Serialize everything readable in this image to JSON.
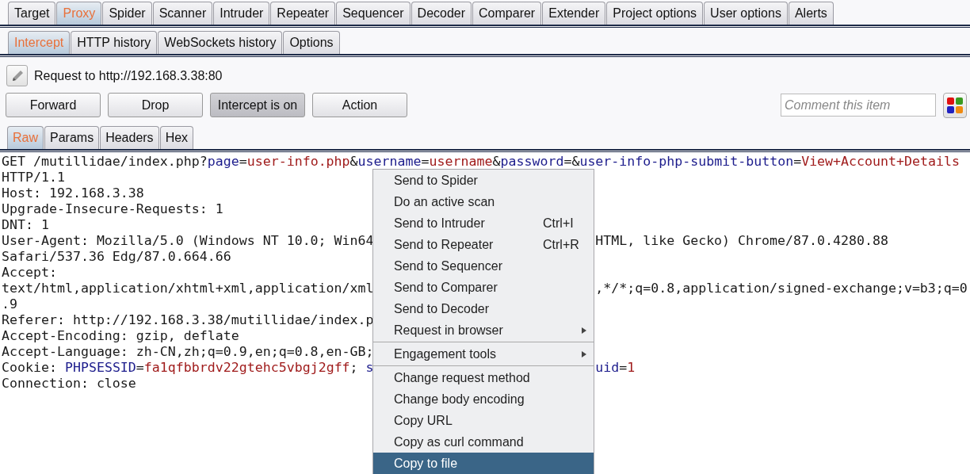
{
  "main_tabs": [
    {
      "label": "Target",
      "selected": false
    },
    {
      "label": "Proxy",
      "selected": true
    },
    {
      "label": "Spider",
      "selected": false
    },
    {
      "label": "Scanner",
      "selected": false
    },
    {
      "label": "Intruder",
      "selected": false
    },
    {
      "label": "Repeater",
      "selected": false
    },
    {
      "label": "Sequencer",
      "selected": false
    },
    {
      "label": "Decoder",
      "selected": false
    },
    {
      "label": "Comparer",
      "selected": false
    },
    {
      "label": "Extender",
      "selected": false
    },
    {
      "label": "Project options",
      "selected": false
    },
    {
      "label": "User options",
      "selected": false
    },
    {
      "label": "Alerts",
      "selected": false
    }
  ],
  "proxy_tabs": [
    {
      "label": "Intercept",
      "selected": true
    },
    {
      "label": "HTTP history",
      "selected": false
    },
    {
      "label": "WebSockets history",
      "selected": false
    },
    {
      "label": "Options",
      "selected": false
    }
  ],
  "request_target": "Request to http://192.168.3.38:80",
  "buttons": [
    {
      "label": "Forward",
      "pressed": false
    },
    {
      "label": "Drop",
      "pressed": false
    },
    {
      "label": "Intercept is on",
      "pressed": true
    },
    {
      "label": "Action",
      "pressed": false
    }
  ],
  "comment": {
    "placeholder": "Comment this item"
  },
  "view_tabs": [
    {
      "label": "Raw",
      "selected": true
    },
    {
      "label": "Params",
      "selected": false
    },
    {
      "label": "Headers",
      "selected": false
    },
    {
      "label": "Hex",
      "selected": false
    }
  ],
  "request_lines": [
    {
      "left": [
        {
          "kind": "plain",
          "text": "GET /mutillidae/index.php?"
        },
        {
          "kind": "name",
          "text": "page"
        },
        {
          "kind": "plain",
          "text": "="
        },
        {
          "kind": "value",
          "text": "user-info.php"
        },
        {
          "kind": "plain",
          "text": "&"
        },
        {
          "kind": "name",
          "text": "username"
        },
        {
          "kind": "plain",
          "text": "="
        },
        {
          "kind": "value",
          "text": "username"
        },
        {
          "kind": "plain",
          "text": "&"
        },
        {
          "kind": "name",
          "text": "password"
        },
        {
          "kind": "plain",
          "text": "=&"
        },
        {
          "kind": "name",
          "text": "user-info-php-submit-button"
        },
        {
          "kind": "plain",
          "text": "="
        },
        {
          "kind": "value",
          "text": "View+Account+Details"
        }
      ]
    },
    {
      "left": [
        {
          "kind": "plain",
          "text": "HTTP/1.1"
        }
      ]
    },
    {
      "left": [
        {
          "kind": "plain",
          "text": "Host: 192.168.3.38"
        }
      ]
    },
    {
      "left": [
        {
          "kind": "plain",
          "text": "Upgrade-Insecure-Requests: 1"
        }
      ]
    },
    {
      "left": [
        {
          "kind": "plain",
          "text": "DNT: 1"
        }
      ]
    },
    {
      "left": [
        {
          "kind": "plain",
          "text": "User-Agent: Mozilla/5.0 (Windows NT 10.0; Win64"
        }
      ],
      "right": [
        {
          "kind": "plain",
          "text": "HTML, like Gecko) Chrome/87.0.4280.88"
        }
      ]
    },
    {
      "left": [
        {
          "kind": "plain",
          "text": "Safari/537.36 Edg/87.0.664.66"
        }
      ]
    },
    {
      "left": [
        {
          "kind": "plain",
          "text": "Accept:"
        }
      ]
    },
    {
      "left": [
        {
          "kind": "plain",
          "text": "text/html,application/xhtml+xml,application/xml"
        }
      ],
      "right": [
        {
          "kind": "plain",
          "text": ",*/*;q=0.8,application/signed-exchange;v=b3;q=0"
        }
      ]
    },
    {
      "left": [
        {
          "kind": "plain",
          "text": ".9"
        }
      ]
    },
    {
      "left": [
        {
          "kind": "plain",
          "text": "Referer: http://192.168.3.38/mutillidae/index.p"
        }
      ]
    },
    {
      "left": [
        {
          "kind": "plain",
          "text": "Accept-Encoding: gzip, deflate"
        }
      ]
    },
    {
      "left": [
        {
          "kind": "plain",
          "text": "Accept-Language: zh-CN,zh;q=0.9,en;q=0.8,en-GB;"
        }
      ]
    },
    {
      "left": [
        {
          "kind": "plain",
          "text": "Cookie: "
        },
        {
          "kind": "name",
          "text": "PHPSESSID"
        },
        {
          "kind": "plain",
          "text": "="
        },
        {
          "kind": "value",
          "text": "fa1qfbbrdv22gtehc5vbgj2gff"
        },
        {
          "kind": "plain",
          "text": "; "
        },
        {
          "kind": "name",
          "text": "s"
        }
      ],
      "right": [
        {
          "kind": "name",
          "text": "uid"
        },
        {
          "kind": "plain",
          "text": "="
        },
        {
          "kind": "value",
          "text": "1"
        }
      ]
    },
    {
      "left": [
        {
          "kind": "plain",
          "text": "Connection: close"
        }
      ]
    }
  ],
  "context_menu": [
    {
      "kind": "item",
      "label": "Send to Spider",
      "selected": false
    },
    {
      "kind": "item",
      "label": "Do an active scan",
      "selected": false
    },
    {
      "kind": "item",
      "label": "Send to Intruder",
      "shortcut": "Ctrl+I",
      "selected": false
    },
    {
      "kind": "item",
      "label": "Send to Repeater",
      "shortcut": "Ctrl+R",
      "selected": false
    },
    {
      "kind": "item",
      "label": "Send to Sequencer",
      "selected": false
    },
    {
      "kind": "item",
      "label": "Send to Comparer",
      "selected": false
    },
    {
      "kind": "item",
      "label": "Send to Decoder",
      "selected": false
    },
    {
      "kind": "submenu",
      "label": "Request in browser",
      "selected": false
    },
    {
      "kind": "separator"
    },
    {
      "kind": "submenu",
      "label": "Engagement tools",
      "selected": false
    },
    {
      "kind": "separator"
    },
    {
      "kind": "item",
      "label": "Change request method",
      "selected": false
    },
    {
      "kind": "item",
      "label": "Change body encoding",
      "selected": false
    },
    {
      "kind": "item",
      "label": "Copy URL",
      "selected": false
    },
    {
      "kind": "item",
      "label": "Copy as curl command",
      "selected": false
    },
    {
      "kind": "item",
      "label": "Copy to file",
      "selected": true
    }
  ]
}
